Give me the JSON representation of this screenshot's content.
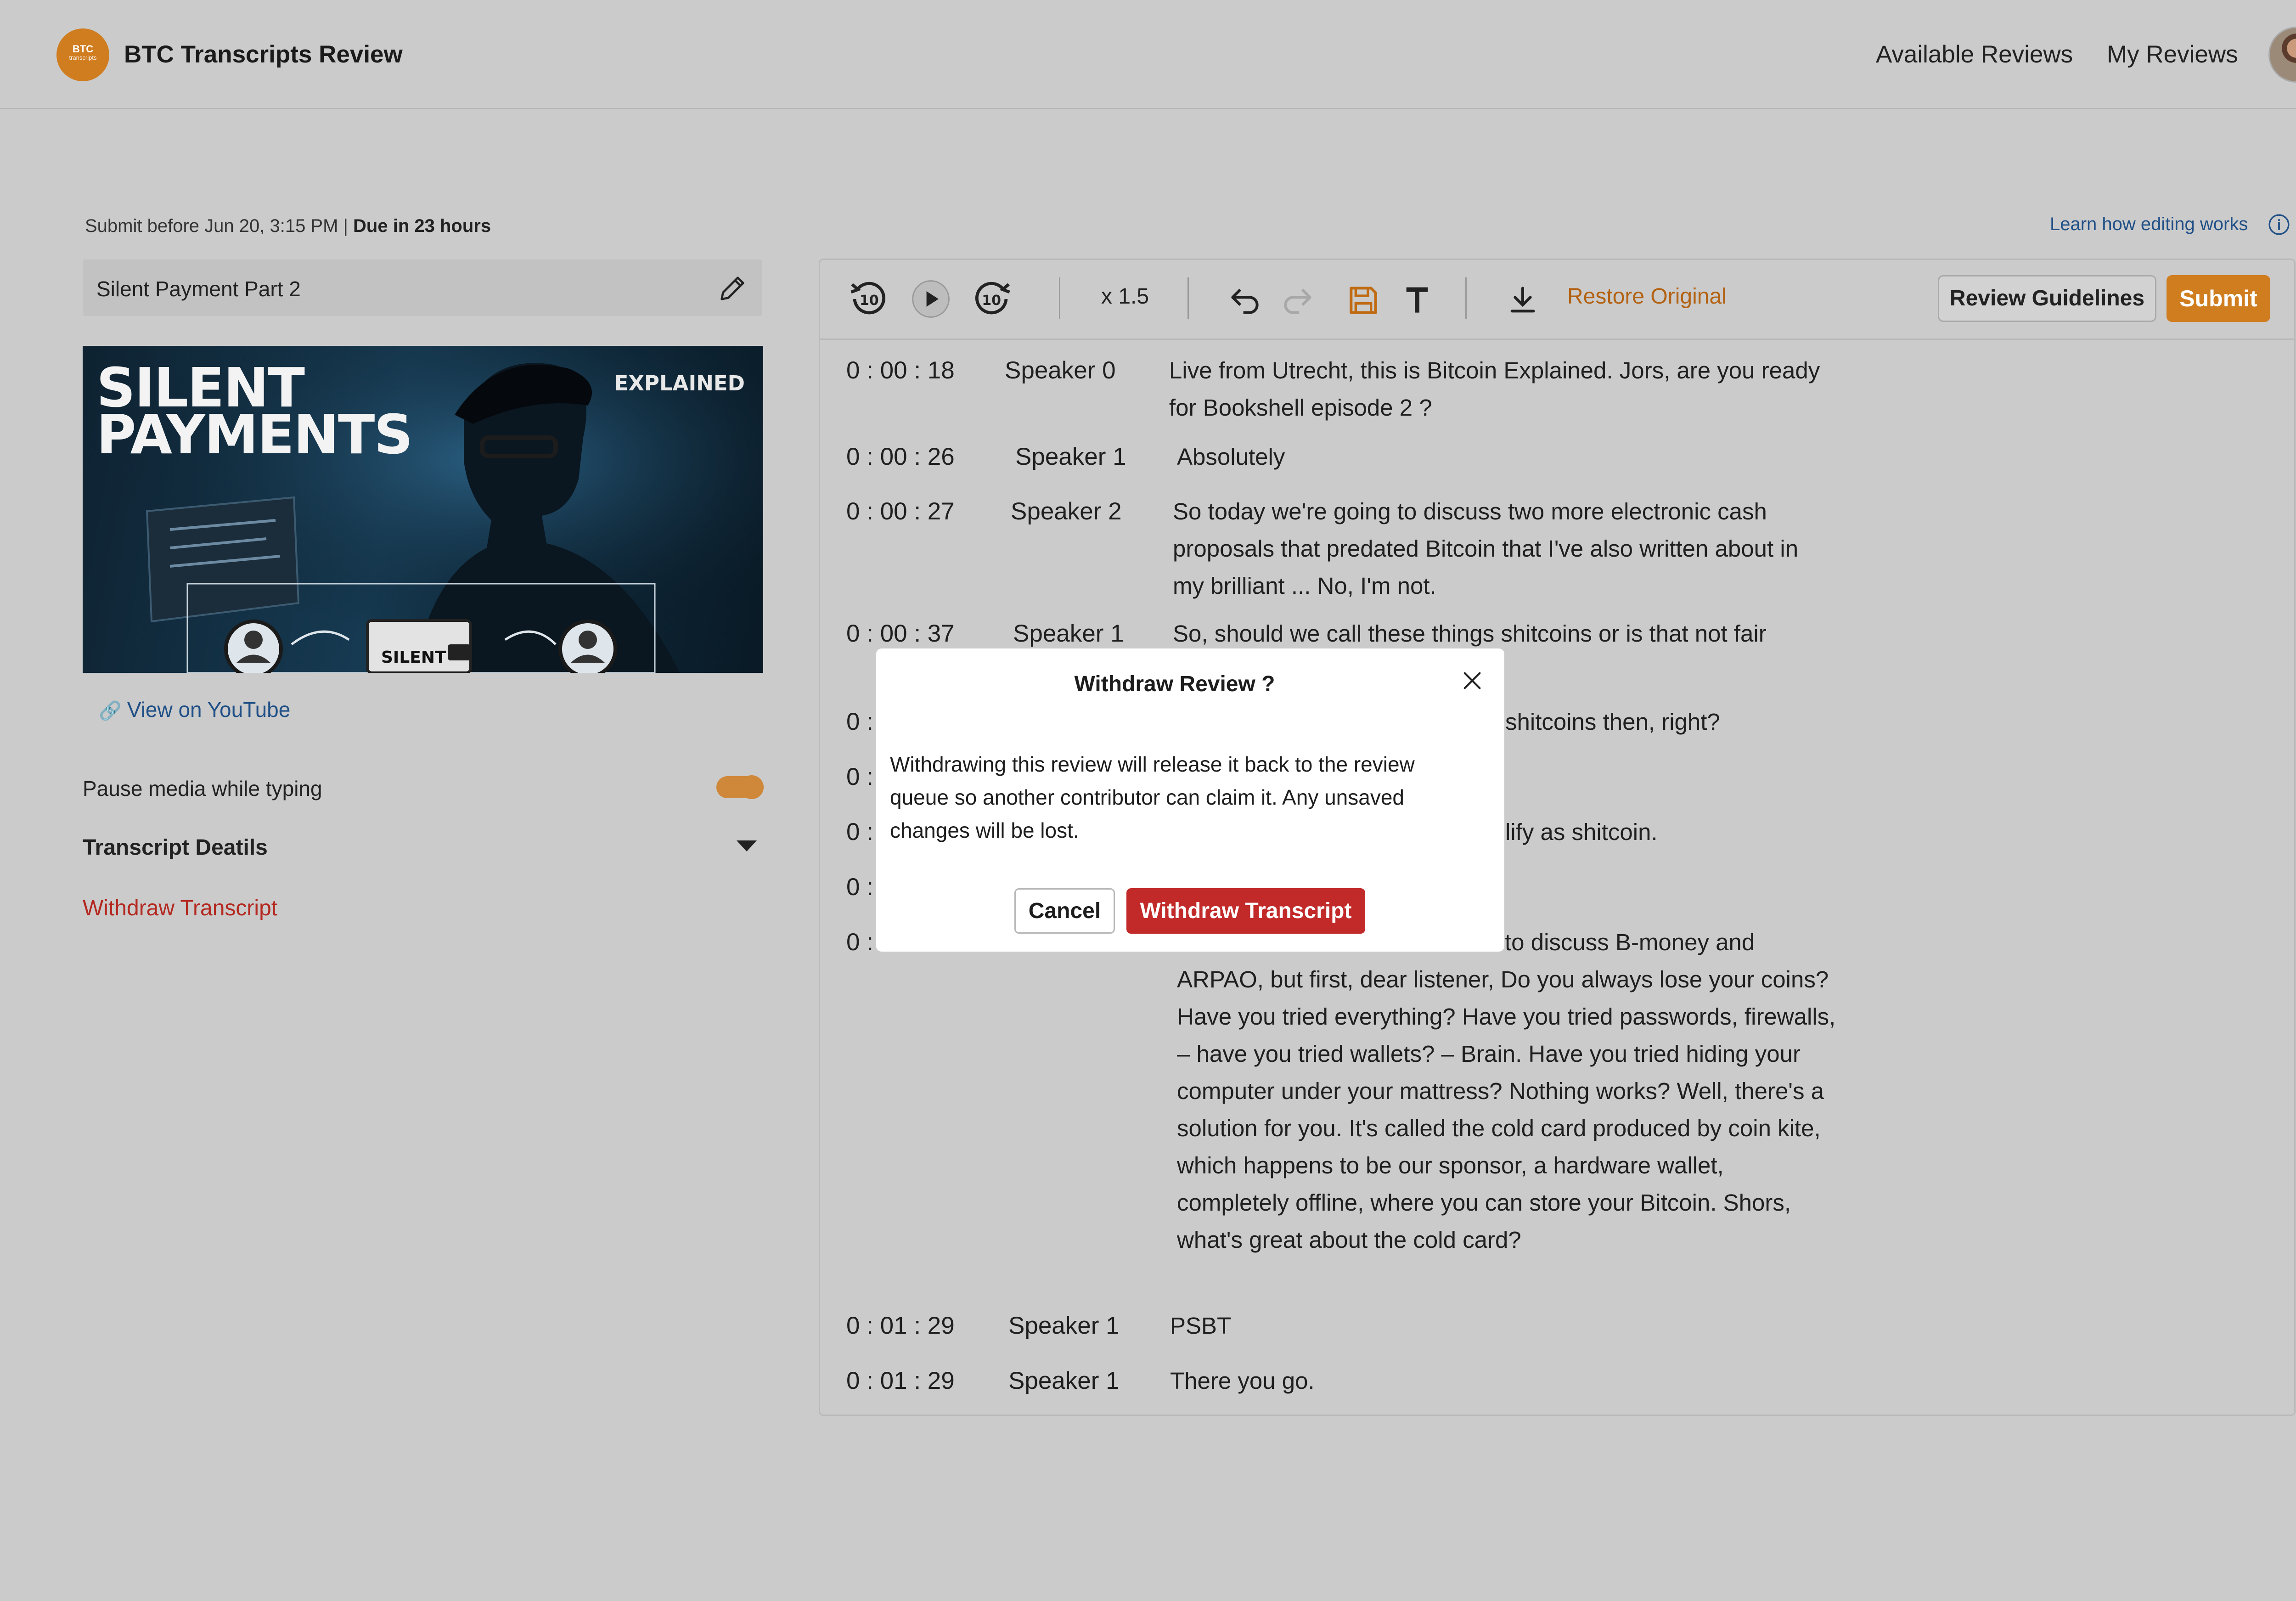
{
  "header": {
    "logo_text": "BTC",
    "logo_subtext": "transcripts",
    "app_title": "BTC Transcripts Review",
    "nav": [
      "Available Reviews",
      "My Reviews"
    ]
  },
  "left": {
    "due_prefix": "Submit before Jun 20, 3:15 PM | ",
    "due_bold": "Due in 23 hours",
    "transcript_title": "Silent Payment Part 2",
    "thumbnail": {
      "title_line1": "SILENT",
      "title_line2": "PAYMENTS",
      "tag": "EXPLAINED",
      "wallet_label": "SILENT"
    },
    "youtube_link": "View on YouTube",
    "pause_label": "Pause media while typing",
    "pause_enabled": true,
    "details_label": "Transcript Deatils",
    "withdraw_link": "Withdraw Transcript"
  },
  "editor": {
    "learn_link": "Learn how editing works",
    "speed": "x 1.5",
    "restore": "Restore Original",
    "guidelines_button": "Review Guidelines",
    "submit_button": "Submit",
    "rows": [
      {
        "time": "0 : 00 : 18",
        "speaker": "Speaker 0",
        "text": "Live from Utrecht, this is Bitcoin Explained. Jors, are you ready for Bookshell episode 2 ?"
      },
      {
        "time": "0 : 00 : 26",
        "speaker": "Speaker 1",
        "text": "Absolutely"
      },
      {
        "time": "0 : 00 : 27",
        "speaker": "Speaker 2",
        "text": "So today we're going to discuss two more electronic cash proposals that predated Bitcoin that I've also written about in my brilliant ... No, I'm not."
      },
      {
        "time": "0 : 00 : 37",
        "speaker": "Speaker 1",
        "text": "So, should we call these things shitcoins or is that not fair"
      },
      {
        "time": "0 :",
        "speaker": "",
        "text": "shitcoins then, right?"
      },
      {
        "time": "0 :",
        "speaker": "",
        "text": ""
      },
      {
        "time": "0 :",
        "speaker": "",
        "text": "lify as shitcoin."
      },
      {
        "time": "0 :",
        "speaker": "",
        "text": ""
      },
      {
        "time": "0 :",
        "speaker": "",
        "text": "to discuss B-money and ARPAO, but first, dear listener, Do you always lose your coins? Have you tried everything? Have you tried passwords, firewalls, – have you tried wallets? – Brain. Have you tried hiding your computer under your mattress? Nothing works? Well, there's a solution for you. It's called the cold card produced by coin kite, which happens to be our sponsor, a hardware wallet, completely offline, where you can store your Bitcoin. Shors, what's great about the cold card?"
      },
      {
        "time": "0 : 01 : 29",
        "speaker": "Speaker 1",
        "text": "PSBT"
      },
      {
        "time": "0 : 01 : 29",
        "speaker": "Speaker 1",
        "text": "There you go."
      }
    ]
  },
  "modal": {
    "title": "Withdraw Review ?",
    "body": "Withdrawing this review will release it back to the review queue so another contributor can claim it. Any unsaved changes will be lost.",
    "cancel": "Cancel",
    "confirm": "Withdraw Transcript"
  },
  "colors": {
    "accent": "#d07d20",
    "danger": "#c22a2a",
    "link": "#1f4f86",
    "background": "#cbcbcb"
  }
}
